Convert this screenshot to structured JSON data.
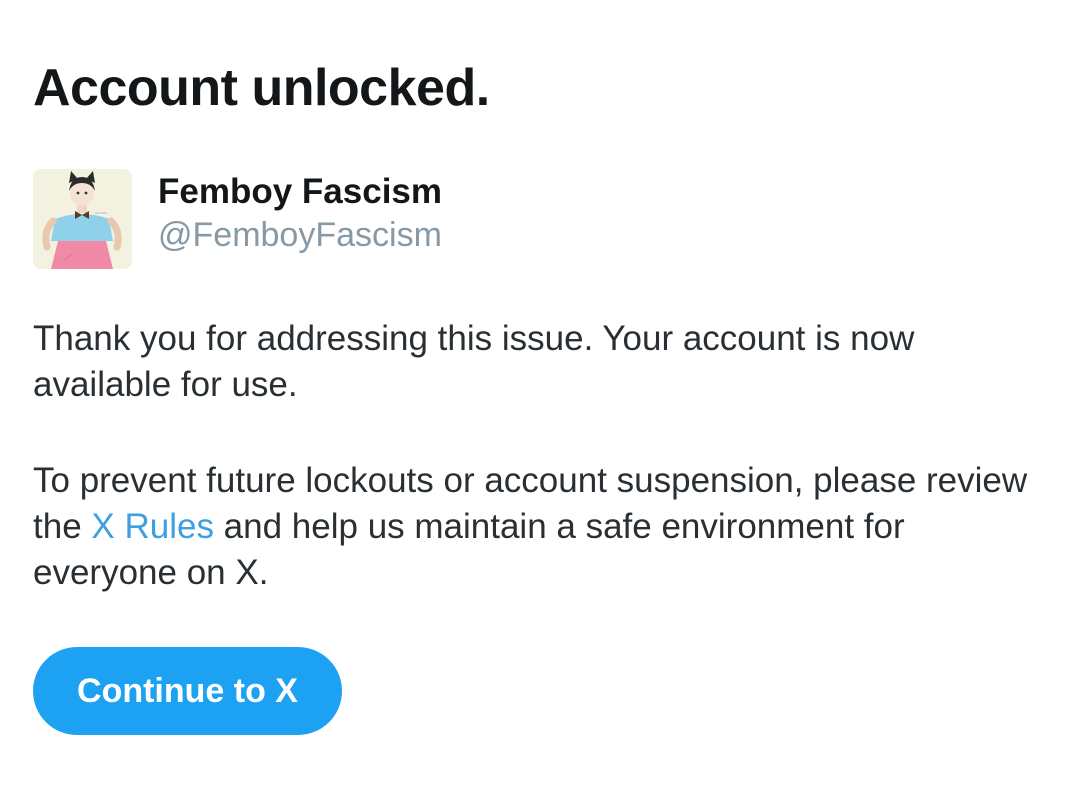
{
  "page": {
    "title": "Account unlocked."
  },
  "profile": {
    "display_name": "Femboy Fascism",
    "handle": "@FemboyFascism",
    "avatar_icon": "profile-avatar"
  },
  "message": {
    "paragraph1": "Thank you for addressing this issue. Your account is now available for use.",
    "paragraph2_before": "To prevent future lockouts or account suspension, please review the ",
    "paragraph2_link": "X Rules",
    "paragraph2_after": " and help us maintain a safe environment for everyone on X."
  },
  "actions": {
    "continue_label": "Continue to X"
  },
  "colors": {
    "accent": "#1da1f2",
    "link": "#3f9fe0",
    "handle": "#8899a6",
    "text": "#14171a"
  }
}
